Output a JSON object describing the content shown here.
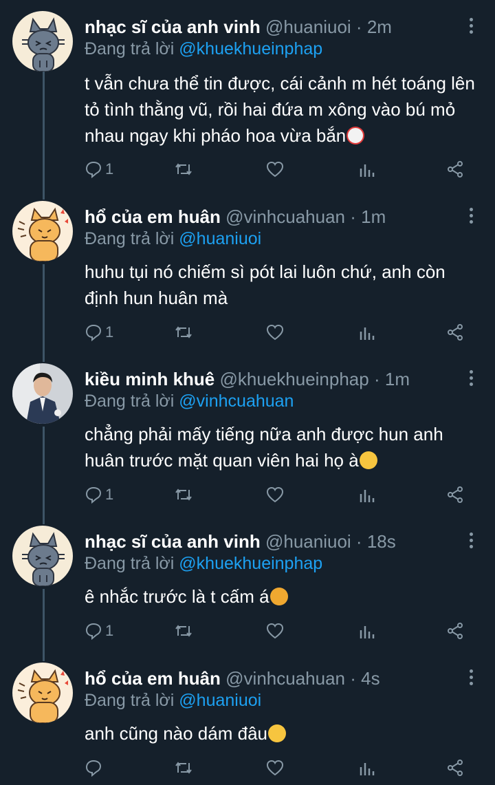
{
  "ui": {
    "background": "#15202b",
    "text_color": "#ffffff",
    "muted_color": "#8899a6",
    "link_color": "#1da1f2"
  },
  "tweets": [
    {
      "name": "nhạc sĩ của anh vinh",
      "handle": "@huaniuoi",
      "dot": "·",
      "time": "2m",
      "reply_prefix": "Đang trả lời",
      "reply_to": "@khuekhueinphap",
      "lines": [
        "t vẫn chưa thể tin được, cái cảnh m hét toáng lên",
        "tỏ tình thằng vũ, rồi hai đứa m xông vào bú mỏ",
        "nhau ngay khi pháo hoa vừa bắn"
      ],
      "emoji": "clown-face",
      "reply_count": "1",
      "avatar": "gray-cat"
    },
    {
      "name": "hổ của em huân",
      "handle": "@vinhcuahuan",
      "dot": "·",
      "time": "1m",
      "reply_prefix": "Đang trả lời",
      "reply_to": "@huaniuoi",
      "lines": [
        "huhu tụi nó chiếm sì pót lai luôn chứ, anh còn",
        "định hun huân mà"
      ],
      "emoji": "",
      "reply_count": "1",
      "avatar": "orange-cat"
    },
    {
      "name": "kiều minh khuê",
      "handle": "@khuekhueinphap",
      "dot": "·",
      "time": "1m",
      "reply_prefix": "Đang trả lời",
      "reply_to": "@vinhcuahuan",
      "lines": [
        "chẳng phải mấy tiếng nữa anh được hun anh",
        "huân trước mặt quan viên hai họ à"
      ],
      "emoji": "hugging-face",
      "reply_count": "1",
      "avatar": "person-photo"
    },
    {
      "name": "nhạc sĩ của anh vinh",
      "handle": "@huaniuoi",
      "dot": "·",
      "time": "18s",
      "reply_prefix": "Đang trả lời",
      "reply_to": "@khuekhueinphap",
      "lines": [
        "ê nhắc trước là t cấm á"
      ],
      "emoji": "angry-face",
      "reply_count": "1",
      "avatar": "gray-cat"
    },
    {
      "name": "hổ của em huân",
      "handle": "@vinhcuahuan",
      "dot": "·",
      "time": "4s",
      "reply_prefix": "Đang trả lời",
      "reply_to": "@huaniuoi",
      "lines": [
        "anh cũng nào dám đâu"
      ],
      "emoji": "pensive-face",
      "reply_count": "",
      "avatar": "orange-cat"
    }
  ]
}
